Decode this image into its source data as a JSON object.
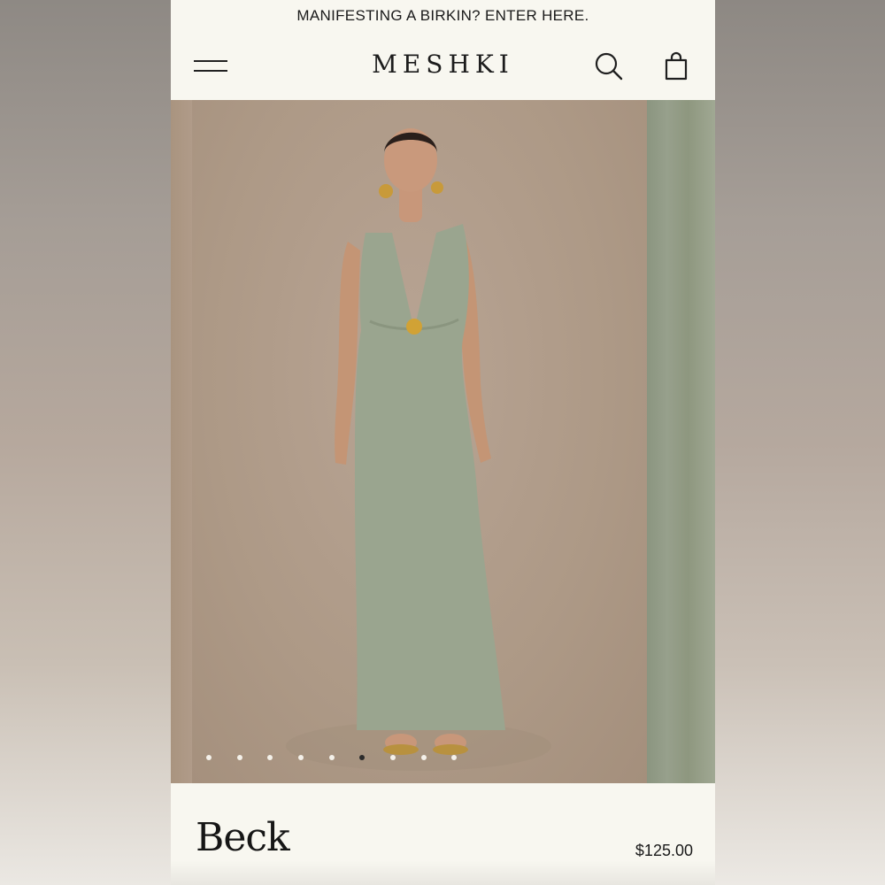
{
  "announcement": {
    "text": "MANIFESTING A BIRKIN? ENTER HERE."
  },
  "header": {
    "logo": "MESHKI",
    "menu_icon": "hamburger-menu-icon",
    "search_icon": "search-icon",
    "cart_icon": "shopping-bag-icon"
  },
  "gallery": {
    "image_count": 9,
    "active_index": 5
  },
  "product": {
    "name": "Beck",
    "price": "$125.00"
  },
  "colors": {
    "page_background": "#f8f7f0",
    "text": "#1a1a1a",
    "dress": "#9aa58f",
    "backdrop": "#b09c8a"
  }
}
